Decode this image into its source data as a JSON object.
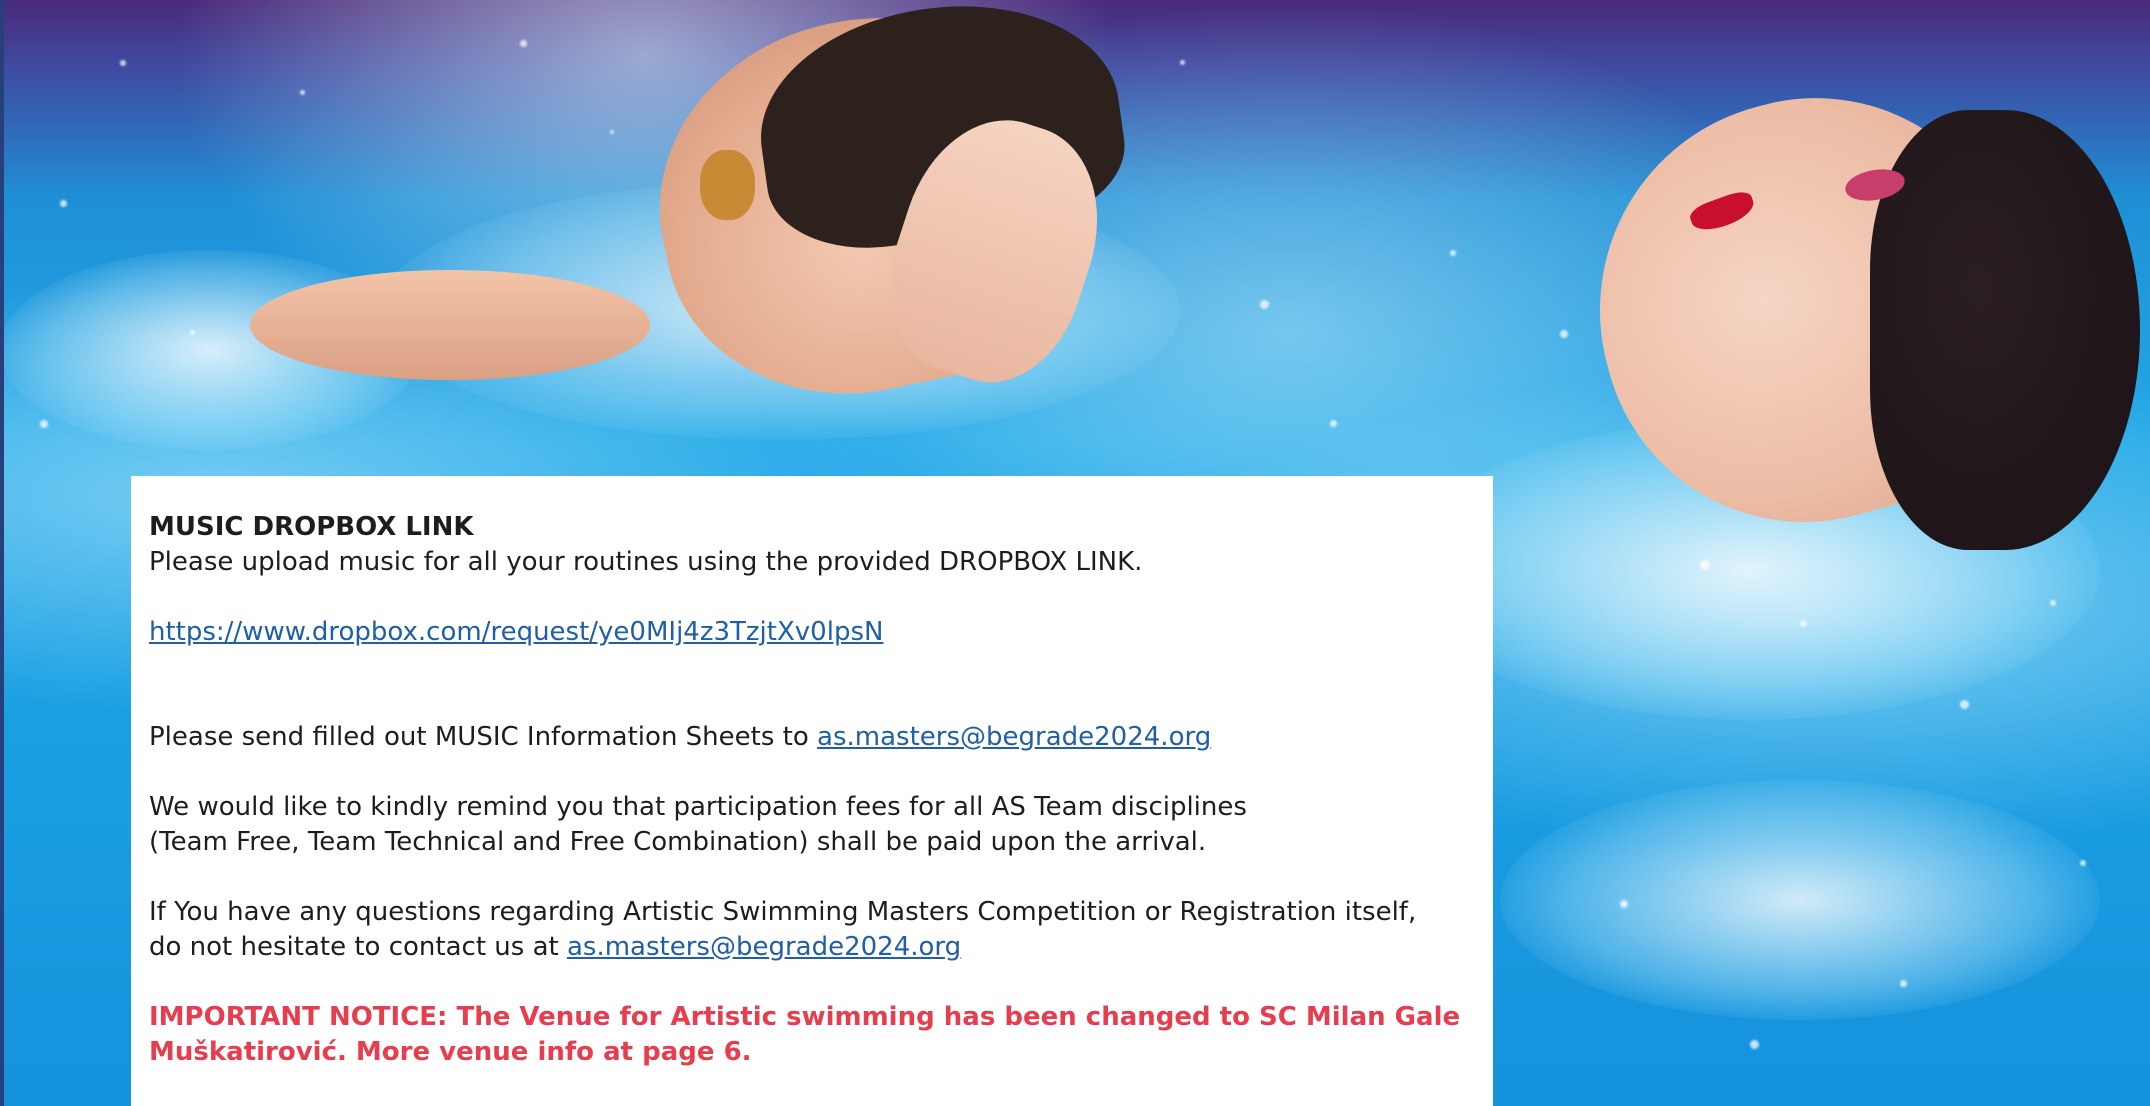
{
  "music": {
    "heading": "MUSIC DROPBOX LINK",
    "instruction": "Please upload music for all your routines using the provided DROPBOX LINK.",
    "dropbox_url": "https://www.dropbox.com/request/ye0MIj4z3TzjtXv0lpsN"
  },
  "info_sheets": {
    "text": "Please send filled out MUSIC Information Sheets to ",
    "email": "as.masters@begrade2024.org "
  },
  "fees": {
    "line1": "We would like to kindly remind you that participation fees for all AS Team disciplines",
    "line2": "(Team Free, Team Technical and Free Combination) shall be paid upon the arrival."
  },
  "questions": {
    "line1": "If You have any questions regarding Artistic Swimming Masters Competition or Registration itself,",
    "line2_text": "do not hesitate to contact us at ",
    "email": "as.masters@begrade2024.org "
  },
  "notice": {
    "line1": "IMPORTANT NOTICE: The Venue for Artistic swimming has been changed to SC Milan Gale",
    "line2": "Muškatirović. More venue info at page 6."
  },
  "colors": {
    "link": "#1f5fa8",
    "notice": "#e63d4f",
    "text": "#1d1d1d"
  }
}
